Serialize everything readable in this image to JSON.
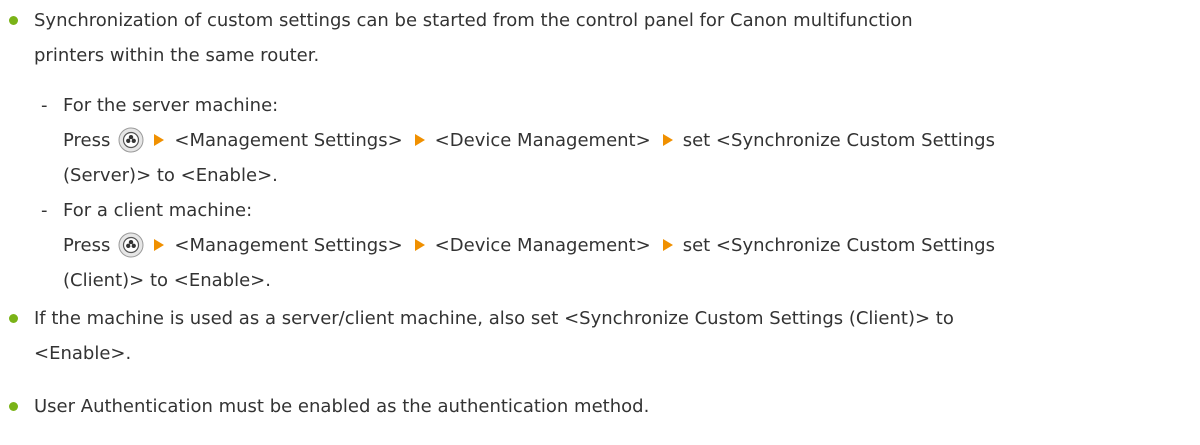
{
  "bullets": [
    {
      "text_line1": "Synchronization of custom settings can be started from the control panel for Canon multifunction",
      "text_line2": "printers within the same router."
    },
    {
      "text_line1": "If the machine is used as a server/client machine, also set <Synchronize Custom Settings (Client)> to",
      "text_line2": "<Enable>."
    },
    {
      "text_line1": "User Authentication must be enabled as the authentication method."
    }
  ],
  "sub_items": [
    {
      "dash": "-",
      "heading": "For the server machine:",
      "press": "Press",
      "step1": "<Management Settings>",
      "step2": "<Device Management>",
      "step3": "set <Synchronize Custom Settings",
      "step3_cont": "(Server)> to <Enable>."
    },
    {
      "dash": "-",
      "heading": "For a client machine:",
      "press": "Press",
      "step1": "<Management Settings>",
      "step2": "<Device Management>",
      "step3": "set <Synchronize Custom Settings",
      "step3_cont": "(Client)> to <Enable>."
    }
  ],
  "icons": {
    "home_key": "home-key-icon",
    "arrow": "arrow-right-icon",
    "bullet": "bullet-dot-icon"
  },
  "colors": {
    "bullet": "#7ab317",
    "arrow": "#f09000",
    "text": "#333333"
  }
}
